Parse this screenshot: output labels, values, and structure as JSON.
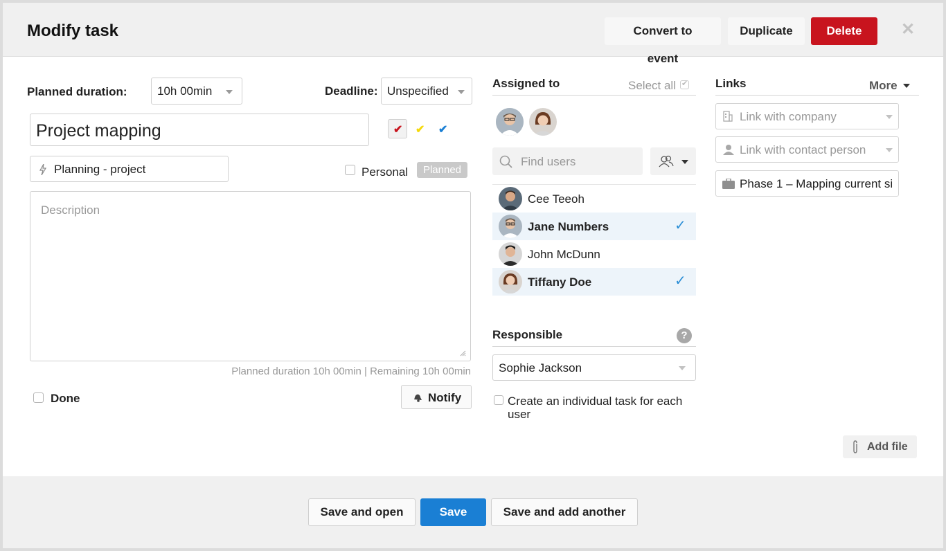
{
  "header": {
    "title": "Modify task",
    "convert_label": "Convert to event",
    "duplicate_label": "Duplicate",
    "delete_label": "Delete",
    "close_glyph": "✕"
  },
  "form": {
    "planned_duration_label": "Planned duration:",
    "planned_duration_value": "10h 00min",
    "deadline_label": "Deadline:",
    "deadline_value": "Unspecified",
    "task_name": "Project mapping",
    "project_value": "Planning - project",
    "personal_label": "Personal",
    "status_badge": "Planned",
    "description_placeholder": "Description",
    "duration_summary": "Planned duration 10h 00min | Remaining 10h 00min",
    "done_label": "Done",
    "notify_label": "Notify",
    "colors": {
      "red": "#c8141e",
      "yellow": "#f5d90a",
      "blue": "#1a7fd4"
    }
  },
  "assigned": {
    "title": "Assigned to",
    "select_all_label": "Select all",
    "find_placeholder": "Find users",
    "users": [
      {
        "name": "Cee Teeoh",
        "selected": false
      },
      {
        "name": "Jane Numbers",
        "selected": true
      },
      {
        "name": "John McDunn",
        "selected": false
      },
      {
        "name": "Tiffany Doe",
        "selected": true
      }
    ]
  },
  "responsible": {
    "title": "Responsible",
    "help_glyph": "?",
    "value": "Sophie Jackson",
    "individual_task_label_1": "Create an individual task for each",
    "individual_task_label_2": "user"
  },
  "links": {
    "title": "Links",
    "more_label": "More",
    "company_placeholder": "Link with company",
    "contact_placeholder": "Link with contact person",
    "project_value": "Phase 1 – Mapping current si",
    "add_file_label": "Add file"
  },
  "footer": {
    "save_open_label": "Save and open",
    "save_label": "Save",
    "save_another_label": "Save and add another"
  }
}
